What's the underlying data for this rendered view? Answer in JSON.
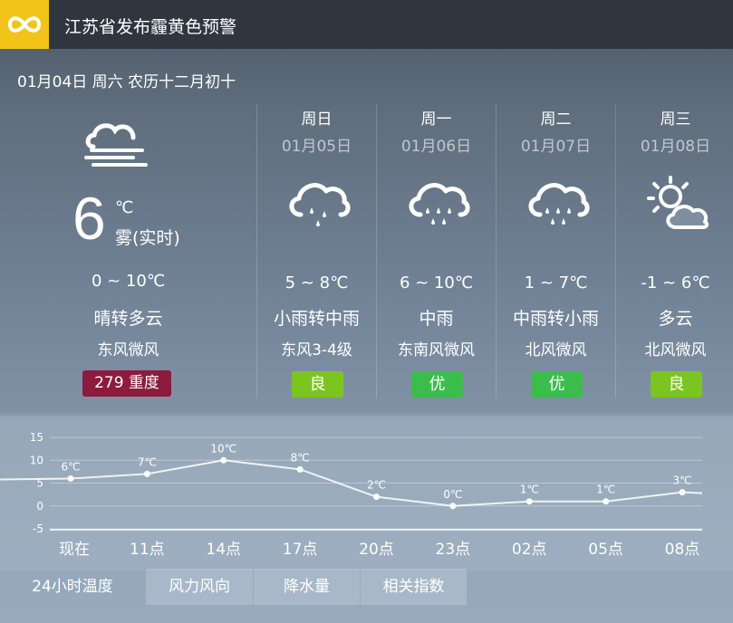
{
  "alert": {
    "title": "江苏省发布霾黄色预警",
    "icon": "infinity-icon"
  },
  "date_line": "01月04日 周六 农历十二月初十",
  "today": {
    "icon": "fog-icon",
    "temp": "6",
    "unit": "℃",
    "desc": "雾(实时)",
    "range": "0 ~ 10℃",
    "weather": "晴转多云",
    "wind": "东风微风",
    "aqi": "279  重度",
    "aqi_color": "#8d1b3d"
  },
  "days": [
    {
      "name": "周日",
      "date": "01月05日",
      "icon": "light-rain-icon",
      "range": "5 ~ 8℃",
      "weather": "小雨转中雨",
      "wind": "东风3-4级",
      "aqi": "良",
      "aqi_color": "#7cc520"
    },
    {
      "name": "周一",
      "date": "01月06日",
      "icon": "rain-icon",
      "range": "6 ~ 10℃",
      "weather": "中雨",
      "wind": "东南风微风",
      "aqi": "优",
      "aqi_color": "#3bbd4c"
    },
    {
      "name": "周二",
      "date": "01月07日",
      "icon": "rain-icon",
      "range": "1 ~ 7℃",
      "weather": "中雨转小雨",
      "wind": "北风微风",
      "aqi": "优",
      "aqi_color": "#3bbd4c"
    },
    {
      "name": "周三",
      "date": "01月08日",
      "icon": "partly-cloudy-icon",
      "range": "-1 ~ 6℃",
      "weather": "多云",
      "wind": "北风微风",
      "aqi": "良",
      "aqi_color": "#7cc520"
    }
  ],
  "chart_data": {
    "type": "line",
    "categories": [
      "现在",
      "11点",
      "14点",
      "17点",
      "20点",
      "23点",
      "02点",
      "05点",
      "08点"
    ],
    "values": [
      6,
      7,
      10,
      8,
      2,
      0,
      1,
      1,
      3
    ],
    "point_labels": [
      "6℃",
      "7℃",
      "10℃",
      "8℃",
      "2℃",
      "0℃",
      "1℃",
      "1℃",
      "3℃"
    ],
    "yticks": [
      "15",
      "10",
      "5",
      "0",
      "-5"
    ],
    "ylim": [
      -5,
      15
    ]
  },
  "tabs": [
    {
      "label": "24小时温度",
      "active": true
    },
    {
      "label": "风力风向",
      "active": false
    },
    {
      "label": "降水量",
      "active": false
    },
    {
      "label": "相关指数",
      "active": false
    }
  ]
}
